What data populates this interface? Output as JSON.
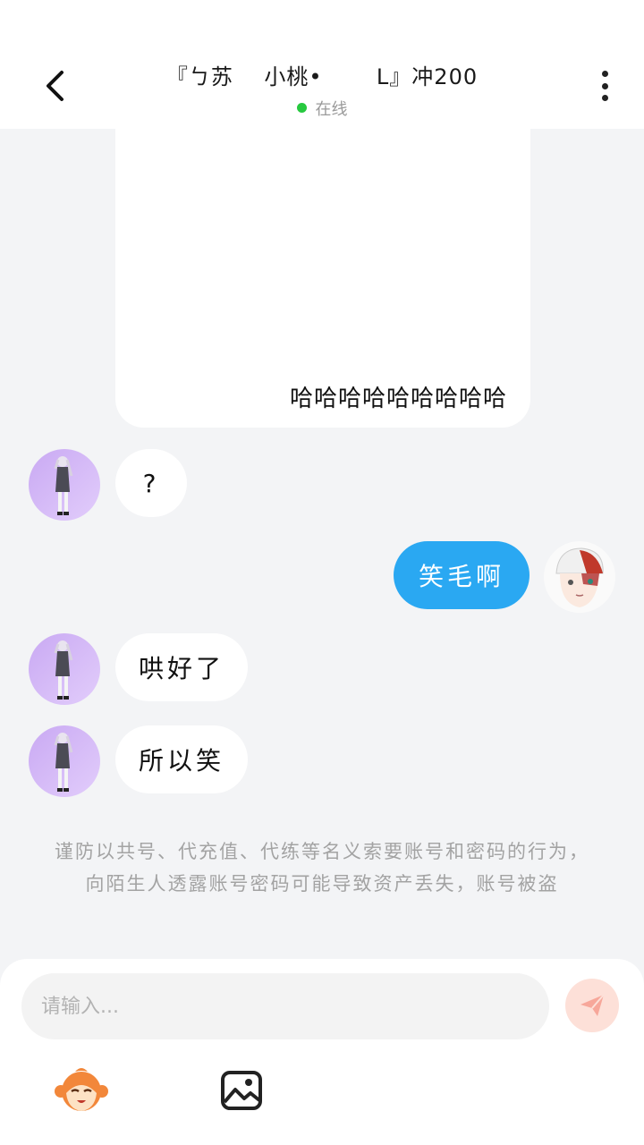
{
  "header": {
    "title": "『ㄅ苏    小桃•       L』冲200",
    "status": "在线"
  },
  "messages": {
    "big_bubble_text": "哈哈哈哈哈哈哈哈哈",
    "msg1": "?",
    "msg2": "笑毛啊",
    "msg3": "哄好了",
    "msg4": "所以笑"
  },
  "notice": "谨防以共号、代充值、代练等名义索要账号和密码的行为，向陌生人透露账号密码可能导致资产丢失，账号被盗",
  "input": {
    "placeholder": "请输入..."
  },
  "colors": {
    "outgoing_bubble": "#2aa8f2",
    "online_dot": "#27c93f",
    "send_button": "#fde0d8"
  }
}
